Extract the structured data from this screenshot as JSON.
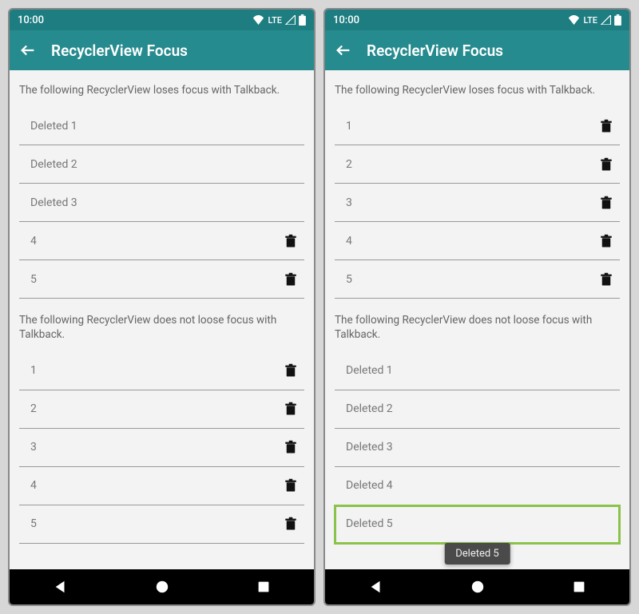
{
  "status": {
    "time": "10:00",
    "network": "LTE"
  },
  "appbar": {
    "title": "RecyclerView Focus"
  },
  "text": {
    "loses": "The following RecyclerView loses focus with Talkback.",
    "keeps": "The following RecyclerView does not loose focus with Talkback."
  },
  "left": {
    "list1": [
      {
        "label": "Deleted 1",
        "hasTrash": false
      },
      {
        "label": "Deleted 2",
        "hasTrash": false
      },
      {
        "label": "Deleted 3",
        "hasTrash": false
      },
      {
        "label": "4",
        "hasTrash": true
      },
      {
        "label": "5",
        "hasTrash": true
      }
    ],
    "list2": [
      {
        "label": "1",
        "hasTrash": true
      },
      {
        "label": "2",
        "hasTrash": true
      },
      {
        "label": "3",
        "hasTrash": true
      },
      {
        "label": "4",
        "hasTrash": true
      },
      {
        "label": "5",
        "hasTrash": true
      }
    ]
  },
  "right": {
    "list1": [
      {
        "label": "1",
        "hasTrash": true
      },
      {
        "label": "2",
        "hasTrash": true
      },
      {
        "label": "3",
        "hasTrash": true
      },
      {
        "label": "4",
        "hasTrash": true
      },
      {
        "label": "5",
        "hasTrash": true
      }
    ],
    "list2": [
      {
        "label": "Deleted 1",
        "hasTrash": false
      },
      {
        "label": "Deleted 2",
        "hasTrash": false
      },
      {
        "label": "Deleted 3",
        "hasTrash": false
      },
      {
        "label": "Deleted 4",
        "hasTrash": false
      },
      {
        "label": "Deleted 5",
        "hasTrash": false,
        "focused": true
      }
    ],
    "toast": "Deleted 5"
  }
}
